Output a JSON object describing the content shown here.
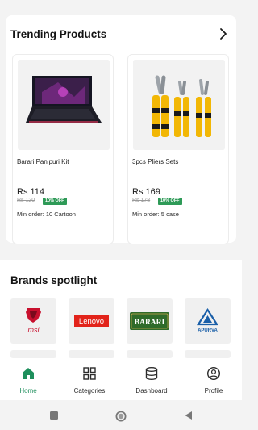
{
  "trending": {
    "title": "Trending Products",
    "products": [
      {
        "name": "Barari Panipuri Kit",
        "price": "Rs 114",
        "mrp": "Rs 120",
        "discount": "10% OFF",
        "min_order": "Min order: 10 Cartoon"
      },
      {
        "name": "3pcs Pliers Sets",
        "price": "Rs 169",
        "mrp": "Rs 178",
        "discount": "10% OFF",
        "min_order": "Min order: 5 case"
      }
    ]
  },
  "brands": {
    "title": "Brands spotlight",
    "items": [
      "msi",
      "Lenovo",
      "BARARI",
      "APURVA"
    ]
  },
  "nav": {
    "items": [
      {
        "label": "Home",
        "icon": "home-icon",
        "active": true
      },
      {
        "label": "Categories",
        "icon": "grid-icon",
        "active": false
      },
      {
        "label": "Dashboard",
        "icon": "database-icon",
        "active": false
      },
      {
        "label": "Profile",
        "icon": "person-icon",
        "active": false
      }
    ]
  },
  "colors": {
    "accent": "#1e8f5c",
    "discount_badge": "#2e9a57",
    "lenovo_red": "#e2231a",
    "msi_red": "#c8102e",
    "barari_green": "#2f6b2a",
    "apurva_blue": "#1a5fa8"
  }
}
